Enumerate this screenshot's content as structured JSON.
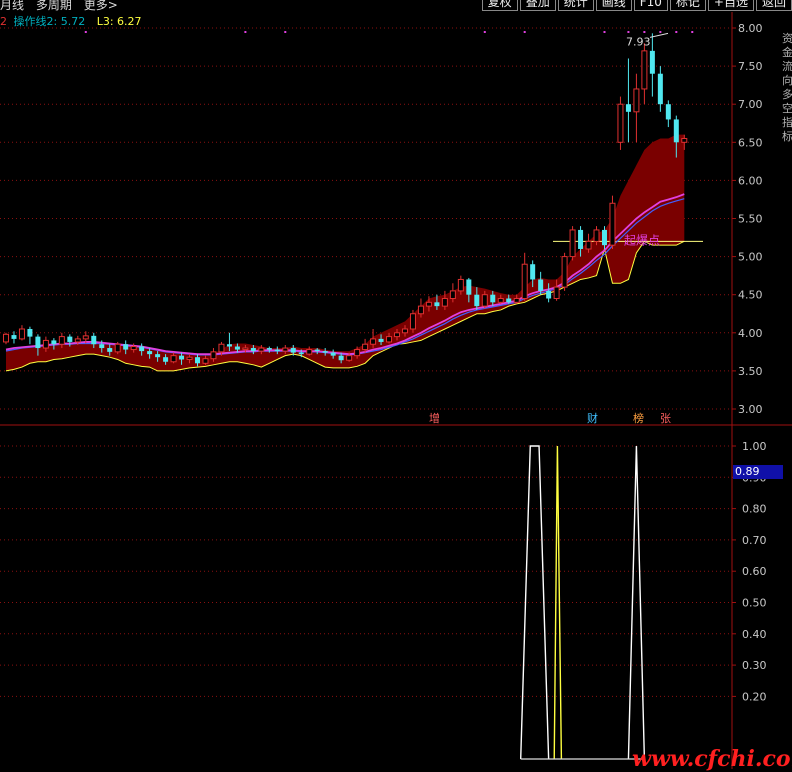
{
  "topbar": {
    "menu_items": [
      "月线",
      "多周期",
      "更多>"
    ],
    "buttons": [
      "复权",
      "叠加",
      "统计",
      "画线",
      "F10",
      "标记",
      "+自选",
      "返回"
    ]
  },
  "legend": {
    "prefix": "2",
    "line2": "操作线2: 5.72",
    "line3": "L3: 6.27"
  },
  "right_labels": "资金流向多空指标",
  "signals": [
    "增",
    "财",
    "榜",
    "张"
  ],
  "annotation": "起爆点",
  "value_box": "0.89",
  "watermark": "www.cfchi.com",
  "colors": {
    "up": "#e03030",
    "down": "#50e8f0",
    "band": "#7a0000",
    "yellow": "#ffff40",
    "magenta": "#e040e0",
    "grid": "#8a1010",
    "white": "#ffffff"
  },
  "chart_data": [
    {
      "type": "candlestick",
      "ylim": [
        2.9,
        8.1
      ],
      "yticks": [
        "8.00",
        "7.50",
        "7.00",
        "6.50",
        "6.00",
        "5.50",
        "5.00",
        "4.50",
        "4.00",
        "3.50",
        "3.00"
      ],
      "max_label": "7.93",
      "annotation": "起爆点",
      "candles": [
        [
          3.88,
          3.98,
          3.85,
          4.0
        ],
        [
          3.97,
          3.92,
          3.86,
          4.02
        ],
        [
          3.92,
          4.05,
          3.9,
          4.1
        ],
        [
          4.05,
          3.95,
          3.85,
          4.08
        ],
        [
          3.95,
          3.8,
          3.7,
          3.98
        ],
        [
          3.8,
          3.9,
          3.75,
          3.95
        ],
        [
          3.9,
          3.85,
          3.78,
          3.93
        ],
        [
          3.85,
          3.95,
          3.8,
          4.0
        ],
        [
          3.95,
          3.88,
          3.82,
          3.98
        ],
        [
          3.88,
          3.92,
          3.84,
          3.96
        ],
        [
          3.92,
          3.96,
          3.86,
          4.02
        ],
        [
          3.96,
          3.85,
          3.8,
          4.0
        ],
        [
          3.85,
          3.8,
          3.74,
          3.9
        ],
        [
          3.8,
          3.75,
          3.7,
          3.85
        ],
        [
          3.75,
          3.85,
          3.72,
          3.88
        ],
        [
          3.85,
          3.78,
          3.72,
          3.9
        ],
        [
          3.78,
          3.82,
          3.74,
          3.86
        ],
        [
          3.82,
          3.76,
          3.7,
          3.86
        ],
        [
          3.76,
          3.72,
          3.66,
          3.8
        ],
        [
          3.72,
          3.68,
          3.62,
          3.76
        ],
        [
          3.68,
          3.62,
          3.58,
          3.72
        ],
        [
          3.62,
          3.7,
          3.6,
          3.74
        ],
        [
          3.7,
          3.65,
          3.58,
          3.74
        ],
        [
          3.65,
          3.68,
          3.6,
          3.72
        ],
        [
          3.68,
          3.6,
          3.56,
          3.72
        ],
        [
          3.6,
          3.66,
          3.58,
          3.7
        ],
        [
          3.66,
          3.75,
          3.62,
          3.8
        ],
        [
          3.75,
          3.85,
          3.7,
          3.88
        ],
        [
          3.85,
          3.82,
          3.76,
          4.0
        ],
        [
          3.82,
          3.78,
          3.74,
          3.86
        ],
        [
          3.78,
          3.8,
          3.74,
          3.84
        ],
        [
          3.8,
          3.76,
          3.72,
          3.84
        ],
        [
          3.76,
          3.8,
          3.72,
          3.84
        ],
        [
          3.8,
          3.78,
          3.74,
          3.82
        ],
        [
          3.78,
          3.76,
          3.72,
          3.82
        ],
        [
          3.76,
          3.8,
          3.72,
          3.84
        ],
        [
          3.8,
          3.74,
          3.7,
          3.84
        ],
        [
          3.74,
          3.72,
          3.68,
          3.78
        ],
        [
          3.72,
          3.78,
          3.7,
          3.82
        ],
        [
          3.78,
          3.76,
          3.72,
          3.8
        ],
        [
          3.76,
          3.74,
          3.7,
          3.8
        ],
        [
          3.74,
          3.7,
          3.66,
          3.78
        ],
        [
          3.7,
          3.64,
          3.6,
          3.74
        ],
        [
          3.64,
          3.7,
          3.62,
          3.74
        ],
        [
          3.7,
          3.78,
          3.66,
          3.82
        ],
        [
          3.78,
          3.85,
          3.74,
          3.92
        ],
        [
          3.85,
          3.92,
          3.8,
          4.05
        ],
        [
          3.92,
          3.88,
          3.84,
          3.98
        ],
        [
          3.88,
          3.95,
          3.86,
          4.0
        ],
        [
          3.95,
          4.0,
          3.9,
          4.05
        ],
        [
          4.0,
          4.05,
          3.95,
          4.1
        ],
        [
          4.05,
          4.25,
          4.0,
          4.3
        ],
        [
          4.25,
          4.35,
          4.2,
          4.45
        ],
        [
          4.35,
          4.4,
          4.28,
          4.48
        ],
        [
          4.4,
          4.35,
          4.3,
          4.5
        ],
        [
          4.35,
          4.45,
          4.3,
          4.55
        ],
        [
          4.45,
          4.55,
          4.4,
          4.65
        ],
        [
          4.55,
          4.7,
          4.5,
          4.75
        ],
        [
          4.7,
          4.5,
          4.4,
          4.72
        ],
        [
          4.5,
          4.35,
          4.3,
          4.6
        ],
        [
          4.35,
          4.5,
          4.32,
          4.55
        ],
        [
          4.5,
          4.4,
          4.35,
          4.55
        ],
        [
          4.4,
          4.45,
          4.38,
          4.5
        ],
        [
          4.45,
          4.4,
          4.38,
          4.5
        ],
        [
          4.4,
          4.45,
          4.38,
          4.5
        ],
        [
          4.45,
          4.9,
          4.42,
          5.05
        ],
        [
          4.9,
          4.7,
          4.6,
          4.95
        ],
        [
          4.7,
          4.55,
          4.5,
          4.8
        ],
        [
          4.55,
          4.45,
          4.4,
          4.65
        ],
        [
          4.45,
          4.6,
          4.42,
          4.7
        ],
        [
          4.6,
          5.0,
          4.55,
          5.05
        ],
        [
          5.0,
          5.35,
          4.95,
          5.4
        ],
        [
          5.35,
          5.1,
          5.0,
          5.4
        ],
        [
          5.1,
          5.2,
          5.05,
          5.3
        ],
        [
          5.2,
          5.35,
          5.15,
          5.4
        ],
        [
          5.35,
          5.15,
          5.1,
          5.4
        ],
        [
          5.15,
          5.7,
          5.1,
          5.8
        ],
        [
          6.5,
          7.0,
          6.4,
          7.1
        ],
        [
          7.0,
          6.9,
          6.5,
          7.6
        ],
        [
          6.9,
          7.2,
          6.5,
          7.4
        ],
        [
          7.2,
          7.7,
          7.0,
          7.8
        ],
        [
          7.7,
          7.4,
          7.1,
          7.93
        ],
        [
          7.4,
          7.0,
          6.9,
          7.5
        ],
        [
          7.0,
          6.8,
          6.7,
          7.05
        ],
        [
          6.8,
          6.5,
          6.3,
          6.85
        ],
        [
          6.5,
          6.55,
          6.4,
          6.6
        ]
      ],
      "ma_magenta": [
        3.78,
        3.8,
        3.81,
        3.82,
        3.83,
        3.84,
        3.85,
        3.86,
        3.86,
        3.87,
        3.88,
        3.88,
        3.87,
        3.86,
        3.85,
        3.84,
        3.83,
        3.82,
        3.8,
        3.78,
        3.76,
        3.75,
        3.74,
        3.73,
        3.72,
        3.72,
        3.72,
        3.73,
        3.74,
        3.75,
        3.76,
        3.76,
        3.77,
        3.77,
        3.77,
        3.77,
        3.77,
        3.76,
        3.76,
        3.76,
        3.75,
        3.74,
        3.73,
        3.72,
        3.73,
        3.75,
        3.78,
        3.8,
        3.83,
        3.86,
        3.9,
        3.95,
        4.0,
        4.06,
        4.11,
        4.16,
        4.22,
        4.27,
        4.3,
        4.32,
        4.34,
        4.36,
        4.38,
        4.4,
        4.42,
        4.48,
        4.52,
        4.55,
        4.57,
        4.6,
        4.66,
        4.75,
        4.82,
        4.9,
        5.0,
        5.08,
        5.2,
        5.3,
        5.4,
        5.5,
        5.58,
        5.65,
        5.72,
        5.75,
        5.78,
        5.82
      ],
      "ma_blue": [
        3.76,
        3.78,
        3.8,
        3.81,
        3.82,
        3.83,
        3.84,
        3.85,
        3.85,
        3.86,
        3.86,
        3.86,
        3.86,
        3.85,
        3.84,
        3.83,
        3.82,
        3.81,
        3.79,
        3.77,
        3.75,
        3.74,
        3.73,
        3.72,
        3.71,
        3.71,
        3.71,
        3.72,
        3.73,
        3.74,
        3.75,
        3.75,
        3.76,
        3.76,
        3.76,
        3.76,
        3.76,
        3.75,
        3.75,
        3.75,
        3.74,
        3.73,
        3.72,
        3.71,
        3.72,
        3.74,
        3.76,
        3.78,
        3.81,
        3.84,
        3.88,
        3.92,
        3.97,
        4.02,
        4.07,
        4.12,
        4.18,
        4.23,
        4.27,
        4.3,
        4.32,
        4.34,
        4.36,
        4.38,
        4.4,
        4.45,
        4.49,
        4.52,
        4.55,
        4.58,
        4.63,
        4.71,
        4.78,
        4.86,
        4.95,
        5.03,
        5.14,
        5.24,
        5.34,
        5.44,
        5.52,
        5.6,
        5.66,
        5.7,
        5.73,
        5.76
      ],
      "band_upper": [
        3.78,
        3.8,
        3.81,
        3.82,
        3.83,
        3.84,
        3.85,
        3.86,
        3.86,
        3.87,
        3.88,
        3.88,
        3.87,
        3.86,
        3.85,
        3.84,
        3.83,
        3.82,
        3.8,
        3.78,
        3.76,
        3.75,
        3.74,
        3.73,
        3.72,
        3.72,
        3.73,
        3.78,
        3.85,
        3.86,
        3.86,
        3.84,
        3.82,
        3.8,
        3.8,
        3.8,
        3.82,
        3.8,
        3.8,
        3.8,
        3.78,
        3.76,
        3.76,
        3.76,
        3.8,
        3.85,
        3.95,
        4.0,
        4.05,
        4.1,
        4.15,
        4.25,
        4.35,
        4.45,
        4.48,
        4.5,
        4.55,
        4.6,
        4.62,
        4.6,
        4.58,
        4.55,
        4.52,
        4.5,
        4.5,
        4.6,
        4.7,
        4.72,
        4.7,
        4.7,
        4.8,
        5.0,
        5.1,
        5.2,
        5.3,
        5.35,
        5.5,
        5.8,
        6.0,
        6.2,
        6.4,
        6.5,
        6.55,
        6.55,
        6.6,
        6.6
      ],
      "band_lower": [
        3.5,
        3.52,
        3.55,
        3.6,
        3.62,
        3.62,
        3.65,
        3.66,
        3.68,
        3.7,
        3.72,
        3.72,
        3.7,
        3.68,
        3.65,
        3.6,
        3.58,
        3.56,
        3.55,
        3.5,
        3.5,
        3.5,
        3.52,
        3.54,
        3.55,
        3.56,
        3.58,
        3.6,
        3.62,
        3.62,
        3.6,
        3.58,
        3.55,
        3.6,
        3.65,
        3.7,
        3.72,
        3.7,
        3.65,
        3.6,
        3.55,
        3.54,
        3.54,
        3.54,
        3.56,
        3.6,
        3.7,
        3.75,
        3.8,
        3.85,
        3.86,
        3.88,
        3.9,
        3.95,
        4.0,
        4.05,
        4.1,
        4.15,
        4.2,
        4.25,
        4.25,
        4.28,
        4.3,
        4.35,
        4.38,
        4.4,
        4.45,
        4.5,
        4.52,
        4.55,
        4.6,
        4.65,
        4.7,
        4.72,
        4.75,
        5.1,
        4.65,
        4.65,
        4.7,
        5.05,
        5.2,
        5.15,
        5.15,
        5.15,
        5.15,
        5.2
      ],
      "hline_value": 5.2
    },
    {
      "type": "line",
      "ylim": [
        0,
        1.1
      ],
      "yticks": [
        "1.00",
        "0.90",
        "0.80",
        "0.70",
        "0.60",
        "0.50",
        "0.40",
        "0.30",
        "0.20"
      ],
      "current_value": "0.89",
      "series": [
        {
          "color": "white",
          "points": [
            [
              65.0,
              0
            ],
            [
              66.2,
              1
            ],
            [
              67.3,
              1
            ],
            [
              68.5,
              0
            ]
          ]
        },
        {
          "color": "yellow",
          "points": [
            [
              69.2,
              0
            ],
            [
              69.6,
              1
            ],
            [
              70.1,
              0
            ]
          ]
        },
        {
          "color": "white",
          "points": [
            [
              78.5,
              0
            ],
            [
              79.5,
              1
            ],
            [
              80.5,
              0
            ]
          ]
        }
      ]
    }
  ]
}
